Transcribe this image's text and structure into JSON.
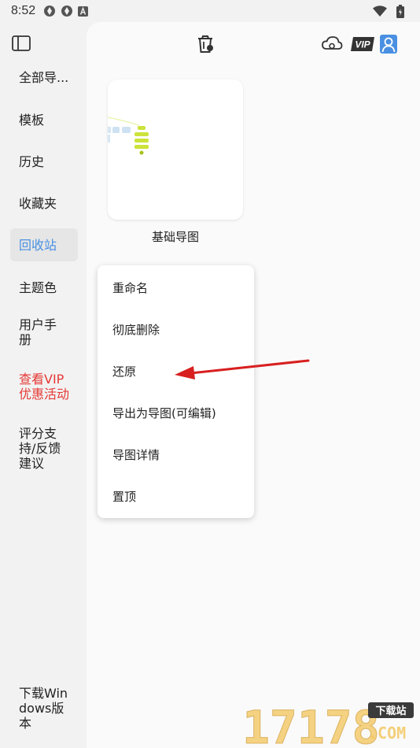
{
  "status_bar": {
    "time": "8:52",
    "icons": [
      "notification-icon",
      "notification-icon",
      "a-badge-icon",
      "wifi-icon",
      "battery-icon"
    ]
  },
  "sidebar": {
    "items": [
      {
        "label": "全部导..."
      },
      {
        "label": "模板"
      },
      {
        "label": "历史"
      },
      {
        "label": "收藏夹"
      },
      {
        "label": "回收站",
        "active": true
      },
      {
        "label": "主题色"
      },
      {
        "label": "用户手册"
      },
      {
        "label": "查看VIP优惠活动"
      },
      {
        "label": "评分支持/反馈建议"
      },
      {
        "label": "下载Windows版本"
      }
    ]
  },
  "header": {
    "vip_label": "VIP"
  },
  "card": {
    "title": "基础导图"
  },
  "context_menu": {
    "items": [
      {
        "label": "重命名"
      },
      {
        "label": "彻底删除"
      },
      {
        "label": "还原"
      },
      {
        "label": "导出为导图(可编辑)"
      },
      {
        "label": "导图详情"
      },
      {
        "label": "置顶"
      }
    ]
  },
  "watermark": {
    "number": "17178",
    "badge": "下载站",
    "domain": ".COM"
  },
  "colors": {
    "accent": "#4a90e2",
    "vip_red": "#e53935",
    "arrow_red": "#d81f1f",
    "mindmap_green": "#cde23a",
    "watermark_gold": "#f2c45a"
  }
}
